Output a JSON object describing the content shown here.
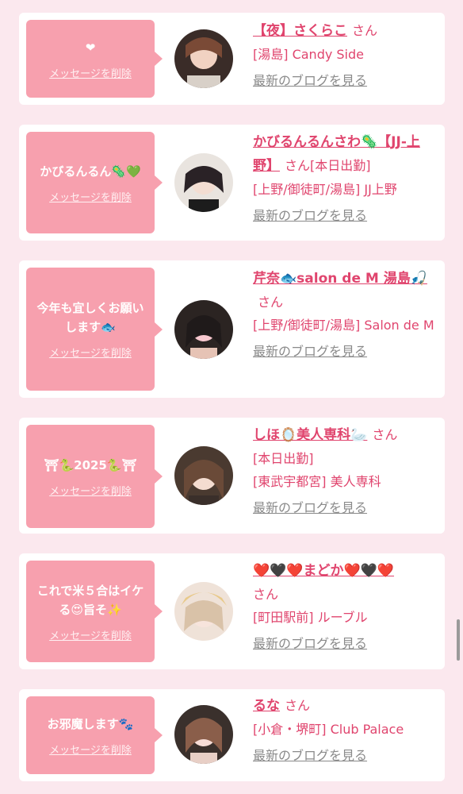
{
  "ui": {
    "delete_label": "メッセージを削除",
    "blog_label": "最新のブログを見る",
    "san_label": "さん"
  },
  "entries": [
    {
      "message": "❤",
      "name": "【夜】さくらこ",
      "meta_lines": [
        "[湯島] Candy Side"
      ]
    },
    {
      "message": "かびるんるん🦠💚",
      "name": "かびるんるんさわ🦠【JJ-上野】",
      "name_suffix": "[本日出勤]",
      "meta_lines": [
        "[上野/御徒町/湯島] JJ上野"
      ]
    },
    {
      "message": "今年も宜しくお願いします🐟",
      "name": "芹奈🐟salon de M 湯島🎣",
      "meta_lines": [
        "[上野/御徒町/湯島] Salon de M"
      ]
    },
    {
      "message": "⛩🐍2025🐍⛩",
      "name": "しほ🪞美人専科🦢",
      "meta_lines": [
        "[本日出勤]",
        "[東武宇都宮] 美人専科"
      ]
    },
    {
      "message": "これで米５合はイケる😍旨そ✨",
      "name": "❤️🖤❤️まどか❤️🖤❤️",
      "meta_lines": [
        "[町田駅前] ルーブル"
      ]
    },
    {
      "message": "お邪魔します🐾",
      "name": "るな",
      "meta_lines": [
        "[小倉・堺町] Club Palace"
      ]
    }
  ],
  "colors": {
    "accent": "#e0456e",
    "bubble": "#f7a0ae",
    "background": "#fbe8ee"
  }
}
